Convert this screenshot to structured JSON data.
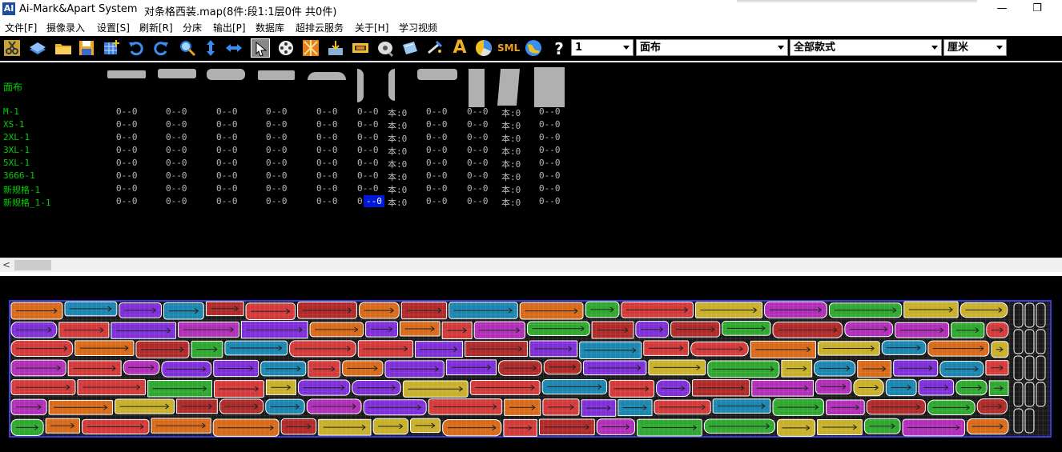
{
  "window": {
    "app_name": "Ai-Mark&Apart System",
    "logo_text": "AI",
    "doc_title": "对条格西装.map(8件:段1:1层0件 共0件)",
    "minimize_glyph": "—",
    "restore_glyph": "❐"
  },
  "menu": {
    "items": [
      "文件[F]",
      "摄像录入",
      "设置[S]",
      "刷新[R]",
      "分床",
      "输出[P]",
      "数据库",
      "超排云服务",
      "关于[H]",
      "学习视频"
    ]
  },
  "toolbar": {
    "icons": [
      "scissors-icon",
      "layer-icon",
      "open-folder-icon",
      "save-icon",
      "grid-add-icon",
      "undo-icon",
      "redo-icon",
      "zoom-icon",
      "vertical-arrows-icon",
      "horizontal-arrows-icon",
      "select-pointer-icon",
      "film-reel-icon",
      "pattern-icon",
      "import-icon",
      "marker-icon",
      "cd-icon",
      "card-icon",
      "wand-icon",
      "text-a-icon",
      "pie-icon",
      "sml-icon",
      "globe-icon",
      "help-icon"
    ],
    "sml_text": "SML",
    "help_text": "?",
    "text_a": "A",
    "layer_select": "1",
    "fabric_select": "面布",
    "style_select": "全部款式",
    "unit_select": "厘米"
  },
  "grid": {
    "fabric_label": "面布",
    "rows": [
      {
        "label": "M-1",
        "cells": [
          "0--0",
          "0--0",
          "0--0",
          "0--0",
          "0--0",
          "0--0",
          "本:0",
          "0--0",
          "0--0",
          "本:0",
          "0--0"
        ]
      },
      {
        "label": "XS-1",
        "cells": [
          "0--0",
          "0--0",
          "0--0",
          "0--0",
          "0--0",
          "0--0",
          "本:0",
          "0--0",
          "0--0",
          "本:0",
          "0--0"
        ]
      },
      {
        "label": "2XL-1",
        "cells": [
          "0--0",
          "0--0",
          "0--0",
          "0--0",
          "0--0",
          "0--0",
          "本:0",
          "0--0",
          "0--0",
          "本:0",
          "0--0"
        ]
      },
      {
        "label": "3XL-1",
        "cells": [
          "0--0",
          "0--0",
          "0--0",
          "0--0",
          "0--0",
          "0--0",
          "本:0",
          "0--0",
          "0--0",
          "本:0",
          "0--0"
        ]
      },
      {
        "label": "5XL-1",
        "cells": [
          "0--0",
          "0--0",
          "0--0",
          "0--0",
          "0--0",
          "0--0",
          "本:0",
          "0--0",
          "0--0",
          "本:0",
          "0--0"
        ]
      },
      {
        "label": "3666-1",
        "cells": [
          "0--0",
          "0--0",
          "0--0",
          "0--0",
          "0--0",
          "0--0",
          "本:0",
          "0--0",
          "0--0",
          "本:0",
          "0--0"
        ]
      },
      {
        "label": "新规格-1",
        "cells": [
          "0--0",
          "0--0",
          "0--0",
          "0--0",
          "0--0",
          "0--0",
          "本:0",
          "0--0",
          "0--0",
          "本:0",
          "0--0"
        ]
      },
      {
        "label": "新规格_1-1",
        "cells": [
          "0--0",
          "0--0",
          "0--0",
          "0--0",
          "0--0",
          "0--0",
          "本:0",
          "0--0",
          "0--0",
          "本:0",
          "0--0"
        ]
      }
    ],
    "selected_cell_text": "--0"
  },
  "scrollbar": {
    "left_glyph": "<"
  },
  "marker": {
    "colors": [
      "#7f2fd8",
      "#d86a1a",
      "#c8b02a",
      "#d43a3a",
      "#1b86b0",
      "#2fa82f",
      "#b12fb8",
      "#b02a2a"
    ]
  }
}
